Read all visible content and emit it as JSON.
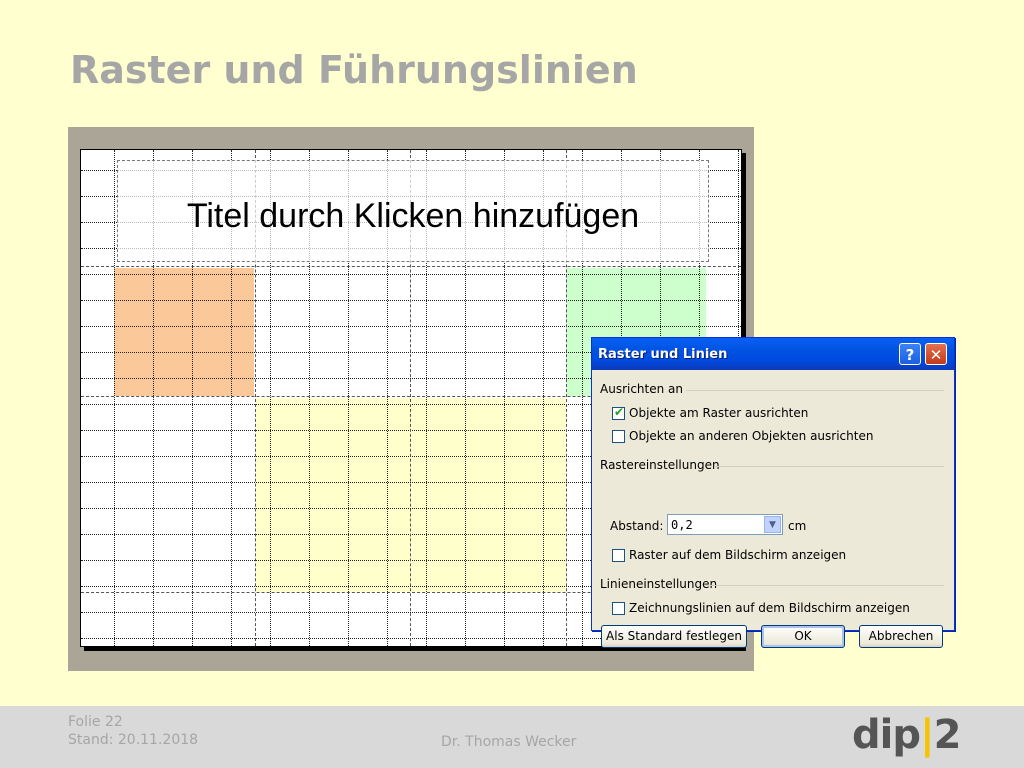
{
  "slide_title": "Raster und Führungslinien",
  "ppt_slide": {
    "title_placeholder": "Titel durch Klicken hinzufügen",
    "colors": {
      "orange": "#fac899",
      "green": "#ccffcc",
      "yellow": "#ffffcc"
    }
  },
  "dialog": {
    "title": "Raster und Linien",
    "help_glyph": "?",
    "close_glyph": "✕",
    "group_align": "Ausrichten an",
    "cb_snap_grid": "Objekte am Raster ausrichten",
    "cb_snap_grid_checked": true,
    "cb_snap_objects": "Objekte an anderen Objekten ausrichten",
    "cb_snap_objects_checked": false,
    "group_grid": "Rastereinstellungen",
    "spacing_label": "Abstand:",
    "spacing_value": "0,2",
    "spacing_unit": "cm",
    "cb_show_grid": "Raster auf dem Bildschirm anzeigen",
    "cb_show_grid_checked": false,
    "group_lines": "Linieneinstellungen",
    "cb_show_guides": "Zeichnungslinien auf dem Bildschirm anzeigen",
    "cb_show_guides_checked": false,
    "btn_default": "Als Standard festlegen",
    "btn_ok": "OK",
    "btn_cancel": "Abbrechen"
  },
  "footer": {
    "slide_number": "Folie 22",
    "date": "Stand: 20.11.2018",
    "author": "Dr. Thomas Wecker",
    "logo_left": "dip",
    "logo_bar": "|",
    "logo_right": "2"
  }
}
